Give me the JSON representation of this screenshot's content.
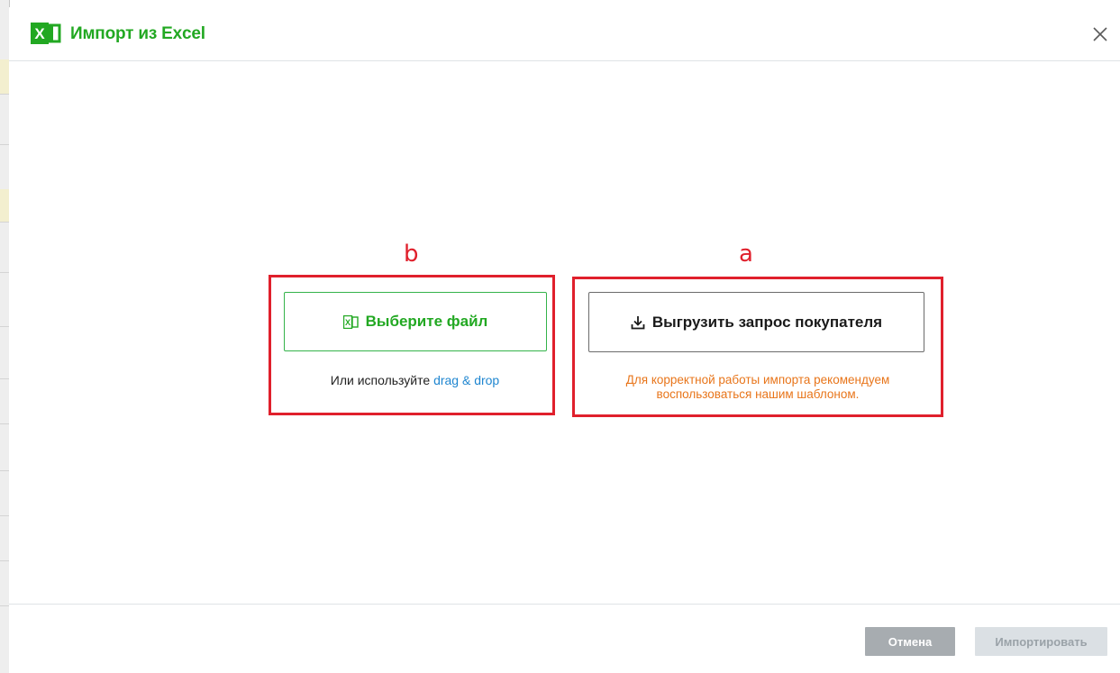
{
  "dialog": {
    "title": "Импорт из Excel"
  },
  "upload": {
    "choose_label": "Выберите файл",
    "hint_prefix": "Или используйте ",
    "hint_link": "drag & drop"
  },
  "template": {
    "download_label": "Выгрузить запрос покупателя",
    "hint": "Для корректной работы импорта рекомендуем воспользоваться нашим шаблоном."
  },
  "annotations": {
    "left_label": "b",
    "right_label": "a"
  },
  "footer": {
    "cancel_label": "Отмена",
    "import_label": "Импортировать"
  },
  "colors": {
    "brand_green": "#22a822",
    "annotation_red": "#e0202c",
    "hint_orange": "#e8751a",
    "link_blue": "#1f86d0"
  },
  "icons": {
    "logo": "excel-icon",
    "close": "close-icon",
    "choose": "excel-small-icon",
    "download": "download-icon"
  }
}
